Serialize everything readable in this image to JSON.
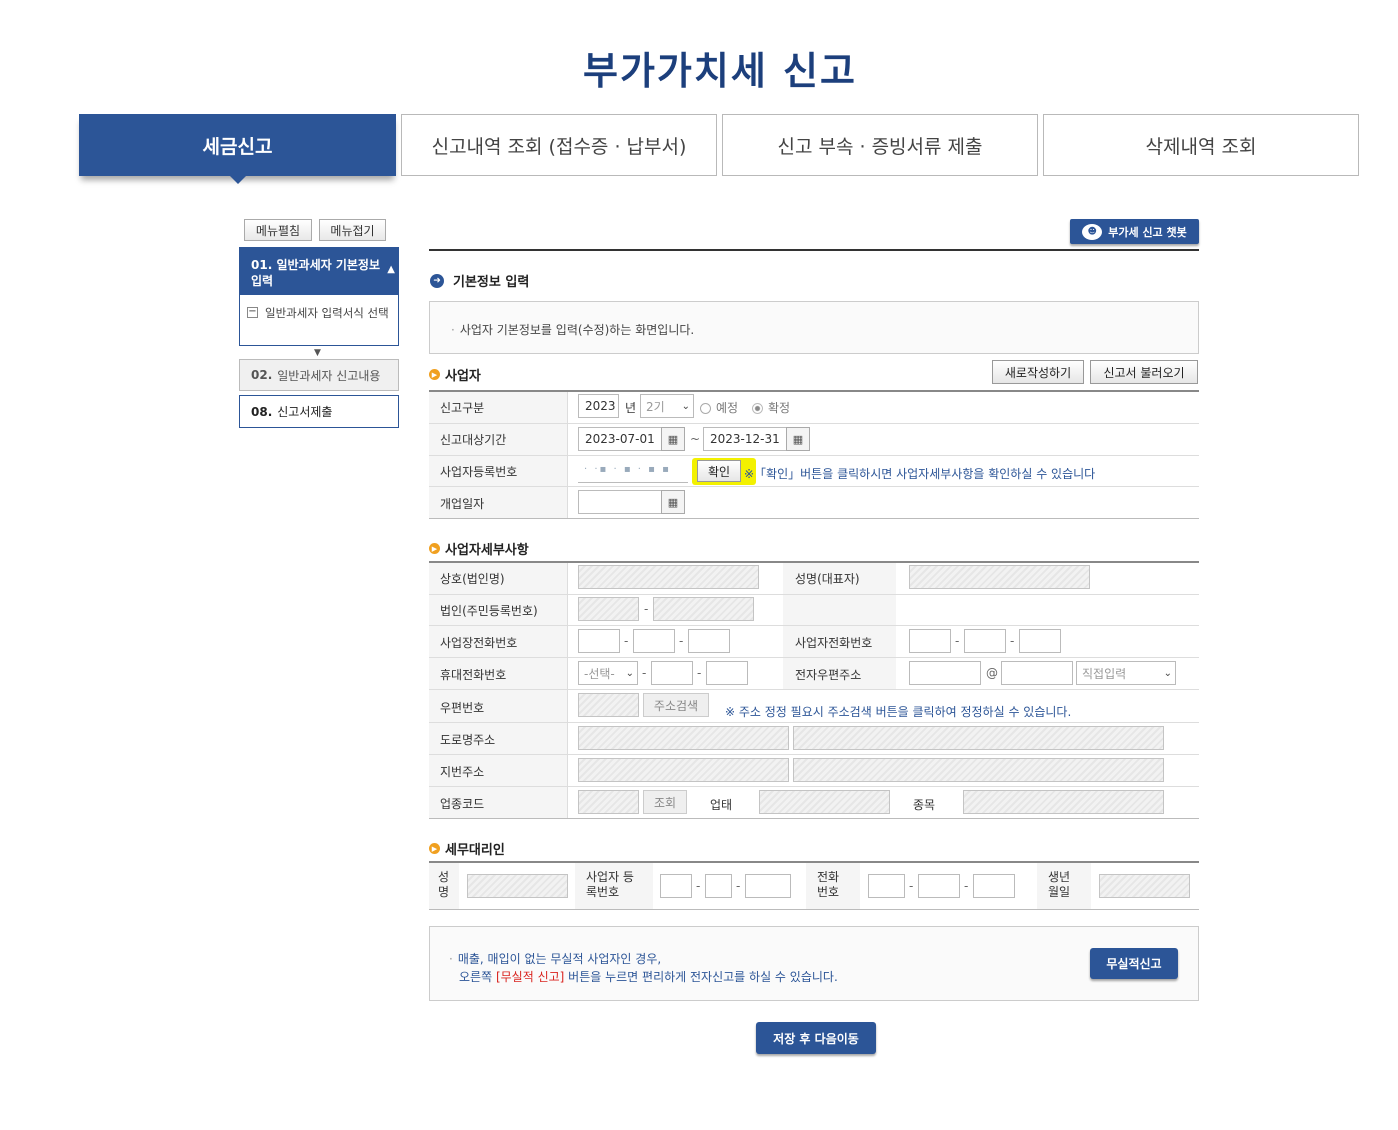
{
  "page_title": "부가가치세 신고",
  "main_tabs": [
    "세금신고",
    "신고내역 조회 (접수증 · 납부서)",
    "신고 부속 · 증빙서류 제출",
    "삭제내역 조회"
  ],
  "side_menu": {
    "expand_label": "메뉴펼침",
    "collapse_label": "메뉴접기",
    "step1_num": "01.",
    "step1_title": "일반과세자 기본정보 입력",
    "step1_sub": "일반과세자 입력서식 선택",
    "step2_num": "02.",
    "step2_title": "일반과세자 신고내용",
    "step8_num": "08.",
    "step8_title": "신고서제출"
  },
  "chatbot_label": "부가세 신고 챗봇",
  "basic_info": {
    "title": "기본정보 입력",
    "description": "사업자 기본정보를 입력(수정)하는 화면입니다."
  },
  "business": {
    "title": "사업자",
    "new_button": "새로작성하기",
    "load_button": "신고서 불러오기",
    "type_label": "신고구분",
    "year": "2023",
    "year_unit": "년",
    "period": "2기",
    "radio_planned": "예정",
    "radio_final": "확정",
    "period_label": "신고대상기간",
    "date_from": "2023-07-01",
    "date_sep": "~",
    "date_to": "2023-12-31",
    "reg_label": "사업자등록번호",
    "reg_value": "· ·▪ · ▪ · ▪ ▪",
    "confirm_button": "확인",
    "confirm_note": "※「확인」버튼을 클릭하시면 사업자세부사항을 확인하실 수 있습니다",
    "open_label": "개업일자"
  },
  "details": {
    "title": "사업자세부사항",
    "company_label": "상호(법인명)",
    "rep_label": "성명(대표자)",
    "corp_label": "법인(주민등록번호)",
    "biz_phone_label": "사업장전화번호",
    "biz_phone2_label": "사업자전화번호",
    "mobile_label": "휴대전화번호",
    "mobile_select": "-선택-",
    "email_label": "전자우편주소",
    "email_at": "@",
    "email_select": "직접입력",
    "zip_label": "우편번호",
    "address_search_button": "주소검색",
    "address_note": "※ 주소 정정 필요시 주소검색 버튼을 클릭하여 정정하실 수 있습니다.",
    "road_label": "도로명주소",
    "jibun_label": "지번주소",
    "industry_label": "업종코드",
    "lookup_button": "조회",
    "biz_type_label": "업태",
    "biz_item_label": "종목"
  },
  "agent": {
    "title": "세무대리인",
    "name_label": "성명",
    "reg_label": "사업자 등록번호",
    "phone_label": "전화 번호",
    "birth_label": "생년 월일"
  },
  "nil_report": {
    "line1": "매출, 매입이 없는 무실적 사업자인 경우,",
    "line2_pre": "오른쪽",
    "line2_highlight": "[무실적 신고]",
    "line2_post": "버튼을 누르면 편리하게 전자신고를 하실 수 있습니다.",
    "button": "무실적신고"
  },
  "save_next_button": "저장 후 다음이동"
}
